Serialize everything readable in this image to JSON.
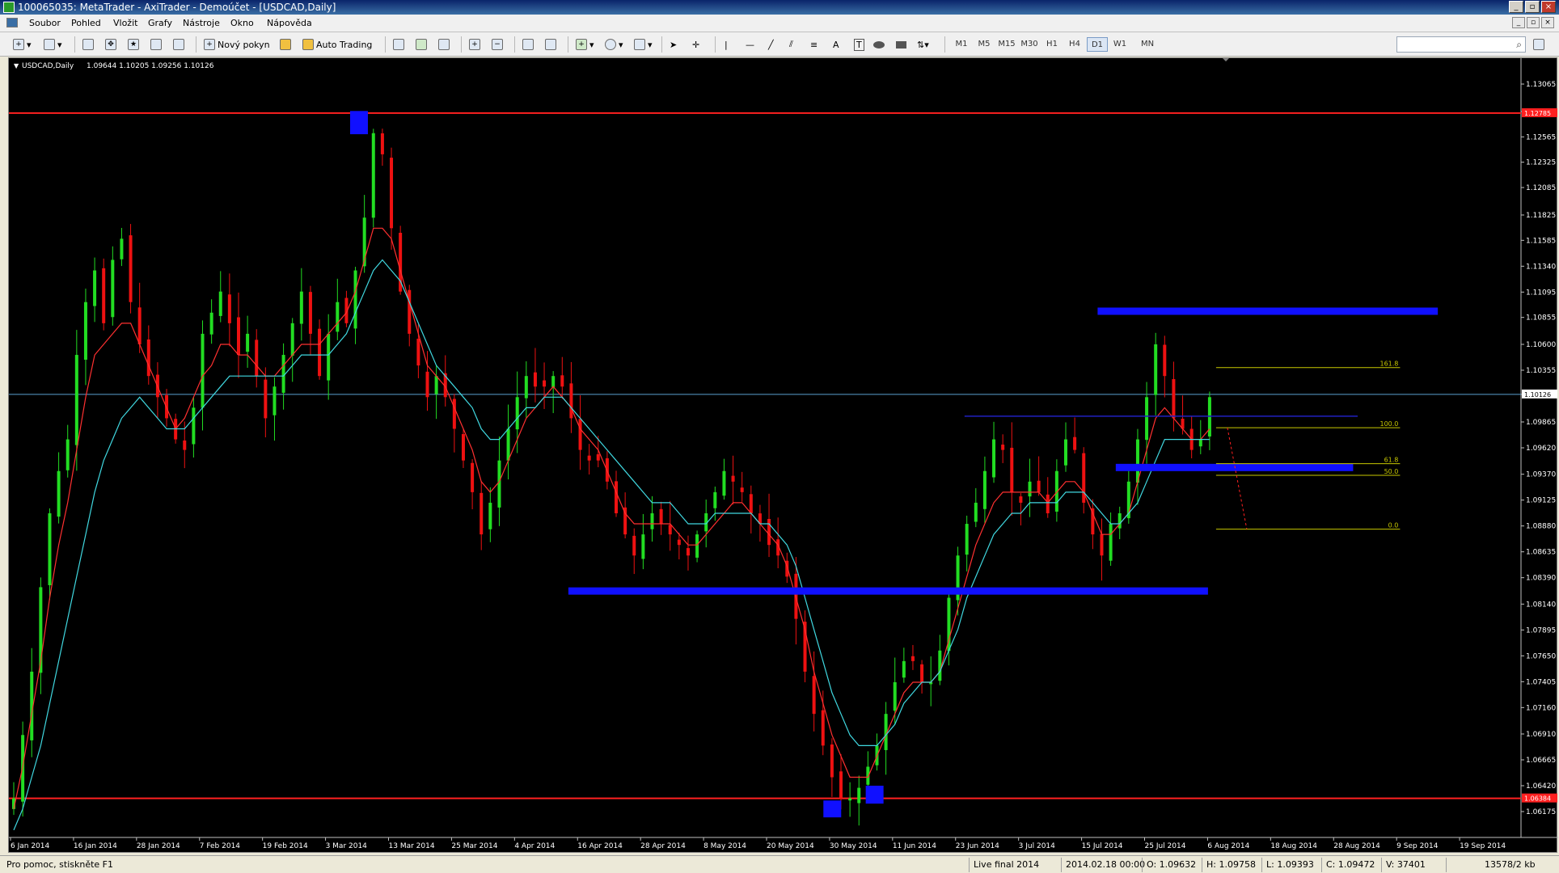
{
  "window": {
    "title": "100065035: MetaTrader - AxiTrader - Demoúčet - [USDCAD,Daily]",
    "controls": [
      "_",
      "▫",
      "×"
    ]
  },
  "menu": [
    "Soubor",
    "Pohled",
    "Vložit",
    "Grafy",
    "Nástroje",
    "Okno",
    "Nápověda"
  ],
  "toolbar": {
    "new_order": "Nový pokyn",
    "auto_trading": "Auto Trading",
    "timeframes": [
      "M1",
      "M5",
      "M15",
      "M30",
      "H1",
      "H4",
      "D1",
      "W1",
      "MN"
    ],
    "active_timeframe": "D1",
    "tools_text": [
      "A",
      "T"
    ]
  },
  "chart_header": {
    "symbol": "USDCAD,Daily",
    "ohlc": "1.09644 1.10205 1.09256 1.10126"
  },
  "chart_data": {
    "type": "candlestick",
    "price_ticks": [
      "1.13065",
      "1.12805",
      "1.12565",
      "1.12325",
      "1.12085",
      "1.11825",
      "1.11585",
      "1.11340",
      "1.11095",
      "1.10855",
      "1.10600",
      "1.10355",
      "1.10126",
      "1.09865",
      "1.09620",
      "1.09370",
      "1.09125",
      "1.08880",
      "1.08635",
      "1.08390",
      "1.08140",
      "1.07895",
      "1.07650",
      "1.07405",
      "1.07160",
      "1.06910",
      "1.06665",
      "1.06420",
      "1.06175"
    ],
    "ylim": [
      1.0593,
      1.1331
    ],
    "date_ticks": [
      "6 Jan 2014",
      "16 Jan 2014",
      "28 Jan 2014",
      "7 Feb 2014",
      "19 Feb 2014",
      "3 Mar 2014",
      "13 Mar 2014",
      "25 Mar 2014",
      "4 Apr 2014",
      "16 Apr 2014",
      "28 Apr 2014",
      "8 May 2014",
      "20 May 2014",
      "30 May 2014",
      "11 Jun 2014",
      "23 Jun 2014",
      "3 Jul 2014",
      "15 Jul 2014",
      "25 Jul 2014",
      "6 Aug 2014",
      "18 Aug 2014",
      "28 Aug 2014",
      "9 Sep 2014",
      "19 Sep 2014"
    ],
    "current_price": "1.10126",
    "level_labels": {
      "top": "1.12785",
      "bottom": "1.06384"
    },
    "close_path": [
      1.063,
      1.069,
      1.075,
      1.083,
      1.09,
      1.094,
      1.097,
      1.105,
      1.11,
      1.113,
      1.108,
      1.114,
      1.116,
      1.11,
      1.106,
      1.103,
      1.101,
      1.099,
      1.097,
      1.096,
      1.1,
      1.107,
      1.109,
      1.111,
      1.108,
      1.105,
      1.107,
      1.103,
      1.099,
      1.102,
      1.105,
      1.108,
      1.111,
      1.107,
      1.103,
      1.107,
      1.11,
      1.108,
      1.113,
      1.118,
      1.126,
      1.124,
      1.117,
      1.111,
      1.107,
      1.104,
      1.101,
      1.103,
      1.101,
      1.098,
      1.095,
      1.092,
      1.088,
      1.091,
      1.095,
      1.098,
      1.101,
      1.103,
      1.102,
      1.102,
      1.103,
      1.102,
      1.099,
      1.096,
      1.095,
      1.095,
      1.093,
      1.09,
      1.088,
      1.086,
      1.088,
      1.09,
      1.089,
      1.088,
      1.087,
      1.086,
      1.088,
      1.09,
      1.092,
      1.094,
      1.093,
      1.092,
      1.09,
      1.089,
      1.087,
      1.086,
      1.084,
      1.08,
      1.075,
      1.071,
      1.068,
      1.065,
      1.063,
      1.063,
      1.064,
      1.066,
      1.068,
      1.071,
      1.074,
      1.076,
      1.076,
      1.074,
      1.074,
      1.077,
      1.082,
      1.086,
      1.089,
      1.091,
      1.094,
      1.097,
      1.096,
      1.092,
      1.091,
      1.093,
      1.092,
      1.09,
      1.094,
      1.097,
      1.096,
      1.091,
      1.088,
      1.086,
      1.089,
      1.09,
      1.093,
      1.097,
      1.101,
      1.106,
      1.103,
      1.099,
      1.098,
      1.096,
      1.097,
      1.101
    ],
    "ma_fast_path": [
      1.062,
      1.066,
      1.071,
      1.076,
      1.082,
      1.087,
      1.091,
      1.096,
      1.101,
      1.105,
      1.106,
      1.107,
      1.108,
      1.108,
      1.106,
      1.104,
      1.102,
      1.1,
      1.098,
      1.099,
      1.101,
      1.103,
      1.104,
      1.106,
      1.106,
      1.105,
      1.105,
      1.104,
      1.103,
      1.103,
      1.104,
      1.105,
      1.106,
      1.106,
      1.106,
      1.107,
      1.108,
      1.109,
      1.111,
      1.114,
      1.117,
      1.117,
      1.116,
      1.113,
      1.11,
      1.107,
      1.104,
      1.103,
      1.102,
      1.1,
      1.098,
      1.096,
      1.093,
      1.092,
      1.093,
      1.095,
      1.097,
      1.099,
      1.1,
      1.101,
      1.102,
      1.101,
      1.1,
      1.098,
      1.097,
      1.096,
      1.094,
      1.092,
      1.09,
      1.089,
      1.089,
      1.089,
      1.089,
      1.089,
      1.088,
      1.087,
      1.087,
      1.088,
      1.089,
      1.09,
      1.091,
      1.091,
      1.09,
      1.089,
      1.088,
      1.087,
      1.085,
      1.082,
      1.079,
      1.075,
      1.072,
      1.069,
      1.067,
      1.065,
      1.065,
      1.065,
      1.067,
      1.069,
      1.071,
      1.073,
      1.074,
      1.074,
      1.074,
      1.075,
      1.078,
      1.081,
      1.084,
      1.087,
      1.089,
      1.091,
      1.092,
      1.092,
      1.092,
      1.092,
      1.092,
      1.091,
      1.092,
      1.093,
      1.093,
      1.092,
      1.09,
      1.088,
      1.088,
      1.089,
      1.09,
      1.093,
      1.096,
      1.099,
      1.1,
      1.099,
      1.098,
      1.097,
      1.097,
      1.098
    ],
    "ma_slow_path": [
      1.06,
      1.062,
      1.065,
      1.068,
      1.072,
      1.076,
      1.08,
      1.084,
      1.088,
      1.092,
      1.095,
      1.097,
      1.099,
      1.1,
      1.101,
      1.1,
      1.099,
      1.098,
      1.098,
      1.098,
      1.099,
      1.1,
      1.101,
      1.102,
      1.103,
      1.103,
      1.103,
      1.103,
      1.103,
      1.103,
      1.103,
      1.104,
      1.105,
      1.105,
      1.105,
      1.105,
      1.106,
      1.107,
      1.109,
      1.111,
      1.113,
      1.114,
      1.113,
      1.112,
      1.11,
      1.108,
      1.106,
      1.104,
      1.103,
      1.102,
      1.101,
      1.1,
      1.098,
      1.097,
      1.097,
      1.098,
      1.099,
      1.1,
      1.1,
      1.101,
      1.101,
      1.101,
      1.1,
      1.099,
      1.098,
      1.097,
      1.096,
      1.095,
      1.094,
      1.093,
      1.092,
      1.091,
      1.091,
      1.091,
      1.09,
      1.089,
      1.089,
      1.089,
      1.09,
      1.09,
      1.09,
      1.09,
      1.09,
      1.089,
      1.089,
      1.088,
      1.087,
      1.085,
      1.082,
      1.079,
      1.076,
      1.073,
      1.071,
      1.069,
      1.068,
      1.068,
      1.068,
      1.069,
      1.07,
      1.072,
      1.073,
      1.074,
      1.074,
      1.075,
      1.077,
      1.079,
      1.082,
      1.084,
      1.086,
      1.088,
      1.089,
      1.09,
      1.09,
      1.091,
      1.091,
      1.091,
      1.091,
      1.092,
      1.092,
      1.092,
      1.091,
      1.09,
      1.089,
      1.089,
      1.09,
      1.091,
      1.093,
      1.095,
      1.097,
      1.097,
      1.097,
      1.097,
      1.097,
      1.097
    ],
    "support_resistance": [
      {
        "price": 1.0826,
        "x_from": 0.37,
        "x_to": 0.793
      },
      {
        "price": 1.1091,
        "x_from": 0.72,
        "x_to": 0.945
      },
      {
        "price": 1.0943,
        "x_from": 0.732,
        "x_to": 0.889
      }
    ],
    "thin_resistance": {
      "price": 1.0992,
      "x_from": 0.632,
      "x_to": 0.892
    },
    "boxes": [
      {
        "price_top": 1.1281,
        "price_bottom": 1.1259,
        "x": 0.231
      },
      {
        "price_top": 1.0628,
        "price_bottom": 1.0612,
        "x": 0.544
      },
      {
        "price_top": 1.0642,
        "price_bottom": 1.0625,
        "x": 0.572
      }
    ],
    "horizontal_levels": [
      1.1279,
      1.063
    ],
    "fibonacci": {
      "x_from": 0.793,
      "x_to": 0.92,
      "levels": [
        {
          "label": "161.8",
          "price": 1.1038
        },
        {
          "label": "100.0",
          "price": 1.0981
        },
        {
          "label": "61.8",
          "price": 1.0947
        },
        {
          "label": "50.0",
          "price": 1.0936
        },
        {
          "label": "0.0",
          "price": 1.0885
        }
      ]
    }
  },
  "status": {
    "help": "Pro pomoc, stiskněte F1",
    "profile": "Live final 2014",
    "datetime": "2014.02.18 00:00",
    "open": "O: 1.09632",
    "high": "H: 1.09758",
    "low": "L: 1.09393",
    "close": "C: 1.09472",
    "volume": "V: 37401",
    "traffic": "13578/2 kb"
  },
  "colors": {
    "bull": "#22dd22",
    "bear": "#ee1111",
    "ma_fast": "#ff3030",
    "ma_slow": "#40d8e0",
    "zone": "#1010ff",
    "level": "#ff2020",
    "fib": "#c8c800",
    "price_line": "#5aa0d0"
  }
}
